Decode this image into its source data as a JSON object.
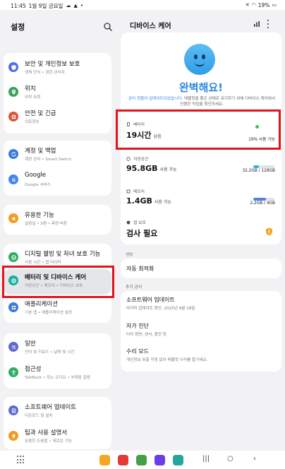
{
  "status": {
    "time": "11:45",
    "date": "1월 9일 금요일",
    "battery": "19%"
  },
  "left": {
    "title": "설정",
    "items": [
      {
        "label": "보안 및 개인정보 보호",
        "sub": "생체 인식 • 권한 관리자",
        "color": "#4f6fe8"
      },
      {
        "label": "위치",
        "sub": "위치 요청",
        "color": "#3aa05b"
      },
      {
        "label": "안전 및 긴급",
        "sub": "의료정보",
        "color": "#e0533b"
      },
      {
        "label": "계정 및 백업",
        "sub": "계정 관리 • Smart Switch",
        "color": "#3a79e0"
      },
      {
        "label": "Google",
        "sub": "Google 서비스",
        "color": "#4285f4"
      },
      {
        "label": "유용한 기능",
        "sub": "실험실 • S펜 • 측면 버튼",
        "color": "#f29c1f"
      },
      {
        "label": "디지털 웰빙 및 자녀 보호 기능",
        "sub": "사용 시간 • 앱 타이머",
        "color": "#2fae63"
      },
      {
        "label": "배터리 및 디바이스 케어",
        "sub": "저장공간 • 메모리 • 디바이스 보호",
        "color": "#16b0a0"
      },
      {
        "label": "애플리케이션",
        "sub": "기본 앱 • 애플리케이션 설정",
        "color": "#3a79e0"
      },
      {
        "label": "일반",
        "sub": "언어 및 키보드 • 날짜 및 시간",
        "color": "#5e6ad2"
      },
      {
        "label": "접근성",
        "sub": "TalkBack • 모노 오디오 • 부재중 알림",
        "color": "#2fae63"
      },
      {
        "label": "소프트웨어 업데이트",
        "sub": "다운로드 및 설치",
        "color": "#5e6ad2"
      },
      {
        "label": "팁과 사용 설명서",
        "sub": "유용한 도움말 • 새로운 기능",
        "color": "#f29c1f"
      }
    ]
  },
  "right": {
    "title": "디바이스 케어",
    "status_title": "완벽해요!",
    "status_desc_link": "관리 현황이 업데이트되었습니다.",
    "status_desc": " 태블릿을 좋은 상태로 유지하기 위해 디바이스 케어에서 진행한 작업을 확인하세요.",
    "battery": {
      "label": "배터리",
      "value": "19시간",
      "unit": "남음",
      "right": "19% 사용 가능"
    },
    "storage": {
      "label": "저장공간",
      "value": "95.8GB",
      "unit": "사용 가능",
      "right": "32.2GB / 128GB",
      "level": 0.25,
      "color": "#2bb8e8"
    },
    "memory": {
      "label": "메모리",
      "value": "1.4GB",
      "unit": "사용 가능",
      "right": "2.2GB / 4GB",
      "level": 0.6,
      "color": "#4f7fe8"
    },
    "protection": {
      "label": "앱 보호",
      "value": "검사 필요"
    },
    "performance_header": "성능",
    "auto_optimize": "자동 최적화",
    "additional_header": "추가 관리",
    "software_update": {
      "title": "소프트웨어 업데이트",
      "sub": "마지막 업데이트 확인: 2025년 8월 18일"
    },
    "self_diag": {
      "title": "자가 진단",
      "sub": "터치 화면, 센서, 충전 등"
    },
    "repair": {
      "title": "수리 모드",
      "sub": "개인정보 유출 걱정 없이 태블릿 수리를 맡기세요."
    }
  },
  "nav": {
    "apps": [
      {
        "name": "file-manager",
        "color": "#f5a623"
      },
      {
        "name": "note-app",
        "color": "#e53935"
      },
      {
        "name": "game-app",
        "color": "#43a047"
      },
      {
        "name": "internet-app",
        "color": "#6a3de8"
      },
      {
        "name": "camera-app",
        "color": "#26a69a"
      }
    ]
  }
}
